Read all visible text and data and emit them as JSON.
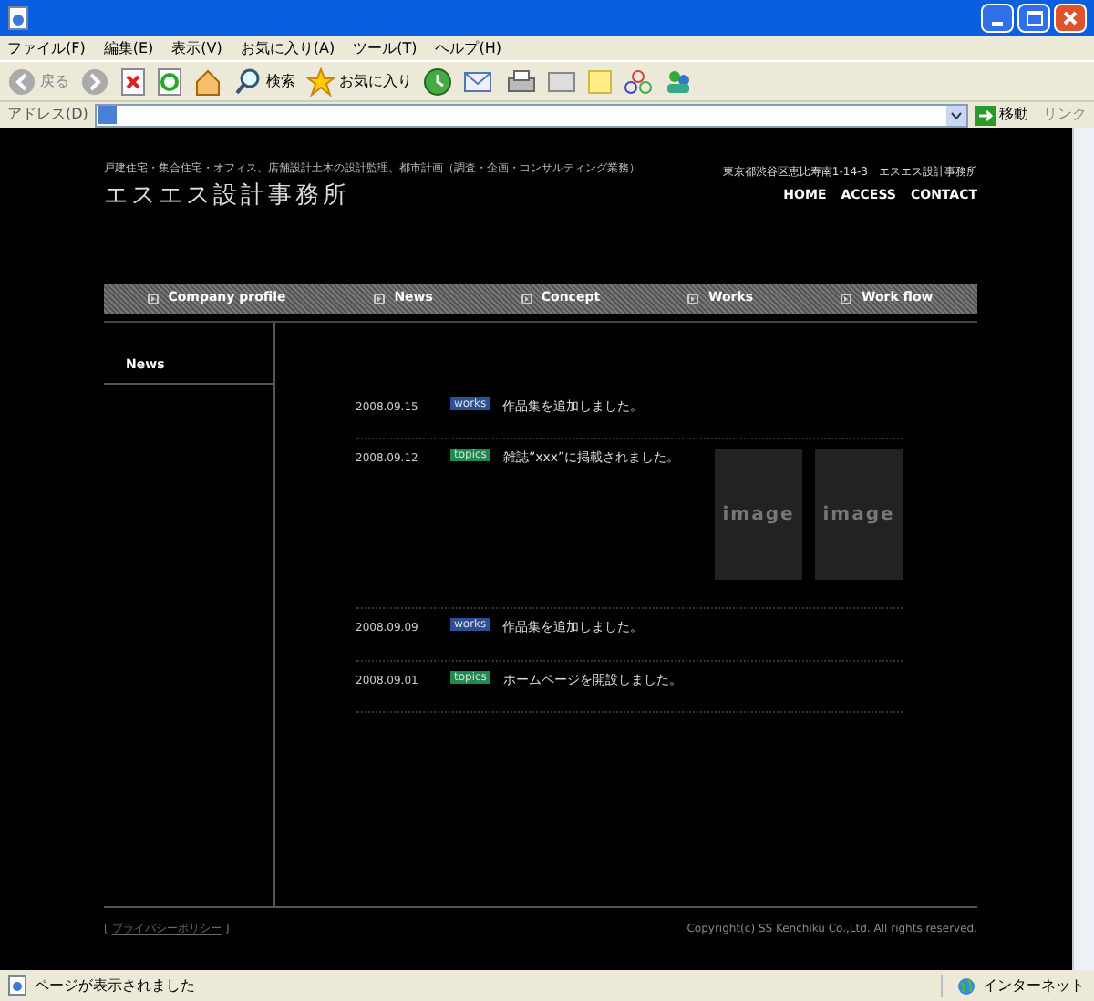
{
  "menu": [
    "ファイル(F)",
    "編集(E)",
    "表示(V)",
    "お気に入り(A)",
    "ツール(T)",
    "ヘルプ(H)"
  ],
  "toolbar": {
    "back": "戻る",
    "search": "検索",
    "favorites": "お気に入り"
  },
  "address_bar": {
    "label": "アドレス(D)",
    "go": "移動",
    "links": "リンク"
  },
  "site": {
    "tagline": "戸建住宅・集合住宅・オフィス、店舗設計土木の設計監理、都市計画（調査・企画・コンサルティング業務）",
    "logo": "エスエス設計事務所",
    "address": "東京都渋谷区恵比寿南1-14-3　エスエス設計事務所",
    "top_nav": [
      "HOME",
      "ACCESS",
      "CONTACT"
    ],
    "main_nav": [
      "Company profile",
      "News",
      "Concept",
      "Works",
      "Work flow"
    ],
    "sidebar_heading": "News",
    "news": [
      {
        "date": "2008.09.15",
        "tag": "works",
        "kind": "works",
        "text": "作品集を追加しました。"
      },
      {
        "date": "2008.09.12",
        "tag": "topics",
        "kind": "topics",
        "text": "雑誌”xxx”に掲載されました。",
        "images": [
          "image",
          "image"
        ]
      },
      {
        "date": "2008.09.09",
        "tag": "works",
        "kind": "works",
        "text": "作品集を追加しました。"
      },
      {
        "date": "2008.09.01",
        "tag": "topics",
        "kind": "topics",
        "text": "ホームページを開設しました。"
      }
    ],
    "privacy_open": "[",
    "privacy_link": "プライバシーポリシー",
    "privacy_close": "]",
    "copyright": "Copyright(c) SS Kenchiku Co.,Ltd. All rights reserved."
  },
  "status_bar": {
    "text": "ページが表示されました",
    "zone": "インターネット"
  }
}
